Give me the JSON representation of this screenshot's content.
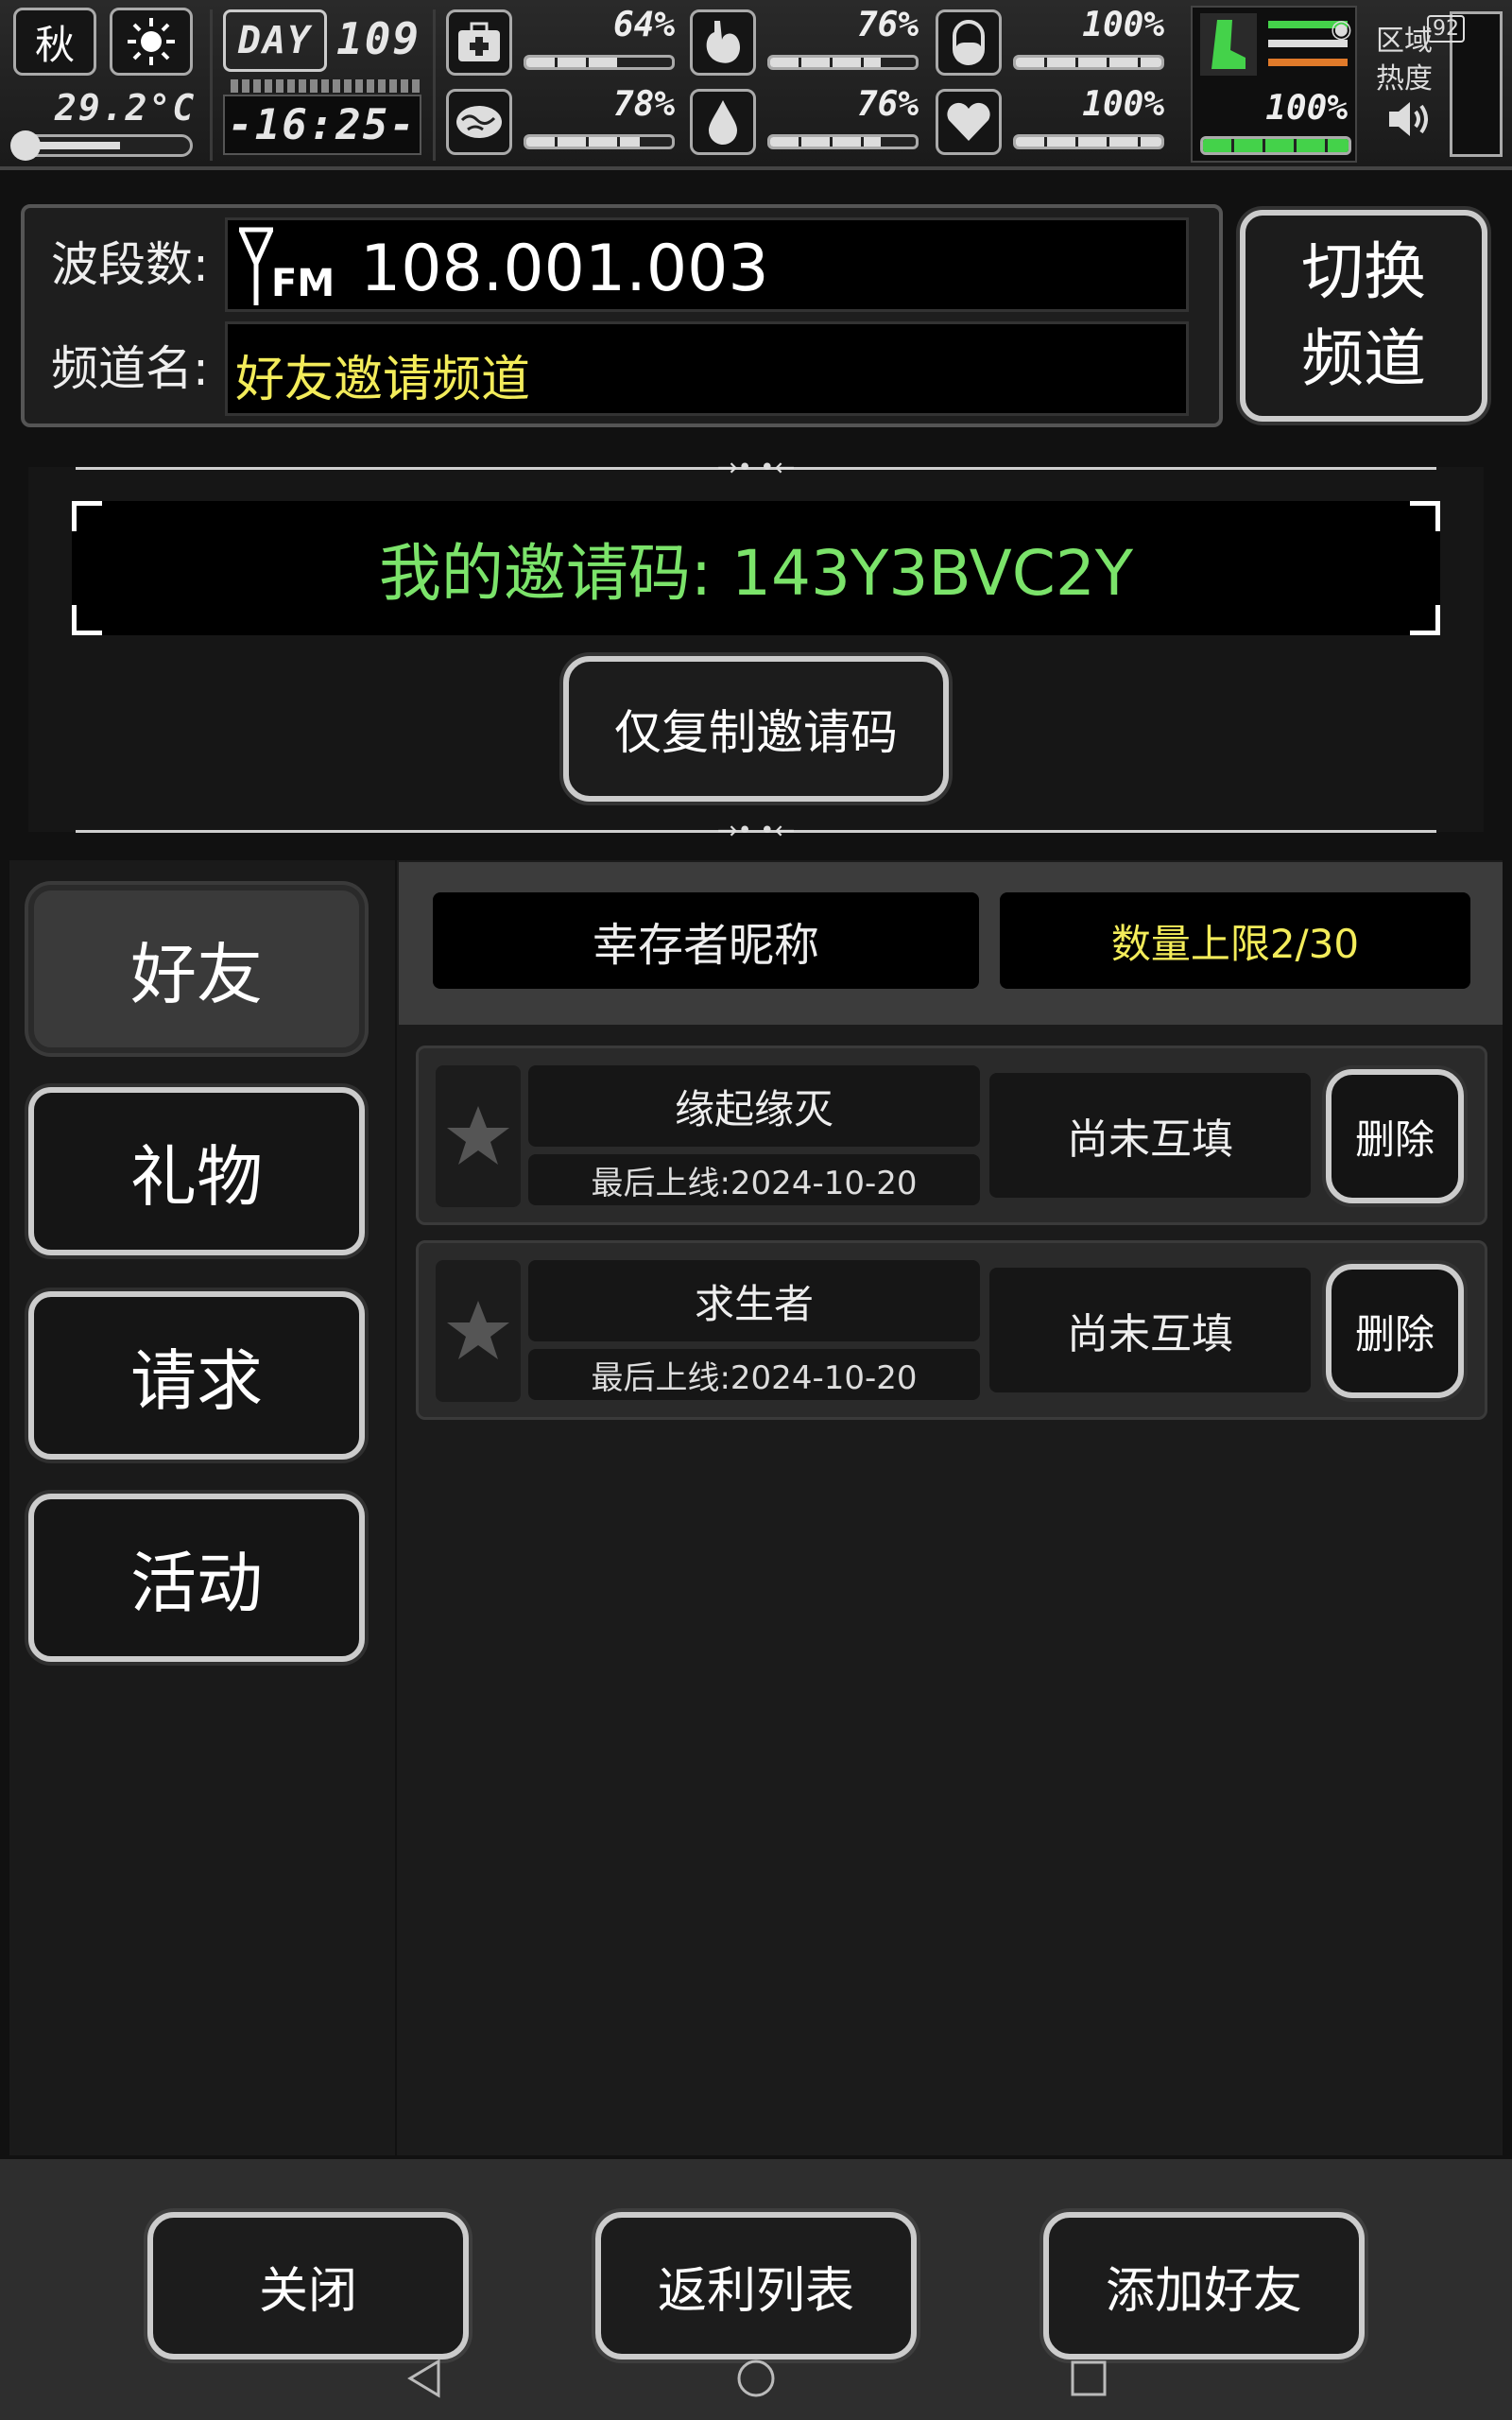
{
  "hud": {
    "season": "秋",
    "temperature": "29.2°C",
    "day_label": "DAY",
    "day_number": "109",
    "clock": "-16:25-",
    "stats": [
      {
        "name": "health",
        "value": "64%",
        "fill": 0.64
      },
      {
        "name": "hunger",
        "value": "76%",
        "fill": 0.76
      },
      {
        "name": "pill",
        "value": "100%",
        "fill": 1.0
      },
      {
        "name": "mental",
        "value": "78%",
        "fill": 0.78
      },
      {
        "name": "thirst",
        "value": "76%",
        "fill": 0.76
      },
      {
        "name": "heart",
        "value": "100%",
        "fill": 1.0
      }
    ],
    "stamina": {
      "value": "100%",
      "fill": 1.0,
      "color": "#44d24a"
    },
    "region_heat_label": "区域热度",
    "status_signal": "92"
  },
  "radio": {
    "band_label": "波段数:",
    "band_prefix": "FM",
    "band_value": "108.001.003",
    "channel_label": "频道名:",
    "channel_value": "好友邀请频道",
    "switch_label_1": "切换",
    "switch_label_2": "频道"
  },
  "invite": {
    "code_text": "我的邀请码:  143Y3BVC2Y",
    "copy_button": "仅复制邀请码"
  },
  "tabs": [
    {
      "label": "好友",
      "active": true
    },
    {
      "label": "礼物",
      "active": false
    },
    {
      "label": "请求",
      "active": false
    },
    {
      "label": "活动",
      "active": false
    }
  ],
  "friends": {
    "header_nickname": "幸存者昵称",
    "header_limit": "数量上限2/30",
    "rows": [
      {
        "name": "缘起缘灭",
        "last_online": "最后上线:2024-10-20",
        "status": "尚未互填",
        "delete": "删除"
      },
      {
        "name": "求生者",
        "last_online": "最后上线:2024-10-20",
        "status": "尚未互填",
        "delete": "删除"
      }
    ]
  },
  "bottom": {
    "close": "关闭",
    "rebate_list": "返利列表",
    "add_friend": "添加好友"
  },
  "colors": {
    "invite_green": "#7be36a",
    "channel_yellow": "#f3ec5a",
    "limit_yellow": "#f3ec5a"
  }
}
